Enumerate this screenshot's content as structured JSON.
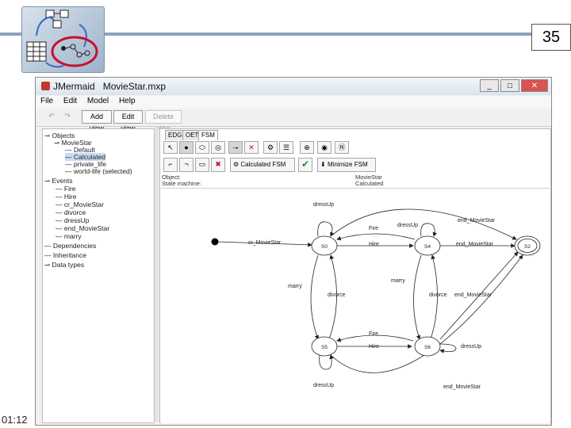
{
  "slide": {
    "number": "35",
    "time": "01:12"
  },
  "window": {
    "app_name": "JMermaid",
    "file_name": "MovieStar.mxp",
    "controls": {
      "minimize": "_",
      "maximize": "□",
      "close": "✕"
    }
  },
  "menu": [
    "File",
    "Edit",
    "Model",
    "Help"
  ],
  "toolbar": {
    "undo": "↶",
    "redo": "↷",
    "add_view": "Add view",
    "edit_view": "Edit view",
    "delete_view": "Delete view"
  },
  "tree": {
    "objects": "Objects",
    "moviestar": "MovieStar",
    "states": [
      "Default",
      "Calculated",
      "private_life",
      "world-life (selected)"
    ],
    "events": "Events",
    "event_items": [
      "Fire",
      "Hire",
      "cr_MovieStar",
      "divorce",
      "dressUp",
      "end_MovieStar",
      "marry"
    ],
    "dependencies": "Dependencies",
    "inheritance": "Inheritance",
    "data_types": "Data types"
  },
  "view_tabs": [
    "EDG",
    "OET",
    "FSM"
  ],
  "icons": {
    "select": "select-icon",
    "initial": "initial-state-icon",
    "state": "state-icon",
    "final": "final-state-icon",
    "transition": "transition-icon",
    "delete": "delete-icon"
  },
  "fsm_buttons": {
    "calculated": "Calculated FSM",
    "minimize": "Minimize FSM"
  },
  "info": {
    "object_label": "Object:",
    "object_value": "MovieStar",
    "sm_label": "State machine:",
    "sm_value": "Calculated"
  },
  "diagram": {
    "states": [
      "S0",
      "S4",
      "S2",
      "S5",
      "S6"
    ],
    "labels": {
      "cr": "cr_MovieStar",
      "fire_top": "Fire",
      "hire_top": "Hire",
      "dressup_s4": "dressUp",
      "dressup_s0": "dressUp",
      "end_top": "end_MovieStar",
      "end_s4": "end_MovieStar",
      "end_s6": "end_MovieStar",
      "end_bottom": "end_MovieStar",
      "marry_left": "marry",
      "divorce_left": "divorce",
      "marry_right": "marry",
      "divorce_right": "divorce",
      "fire_bottom": "Fire",
      "hire_bottom": "Hire",
      "dressup_s6": "dressUp",
      "dressup_s5": "dressUp"
    }
  },
  "colors": {
    "header_line": "#8aa3c0",
    "selection": "#c7dbf3",
    "logo_highlight": "#c8102e"
  }
}
